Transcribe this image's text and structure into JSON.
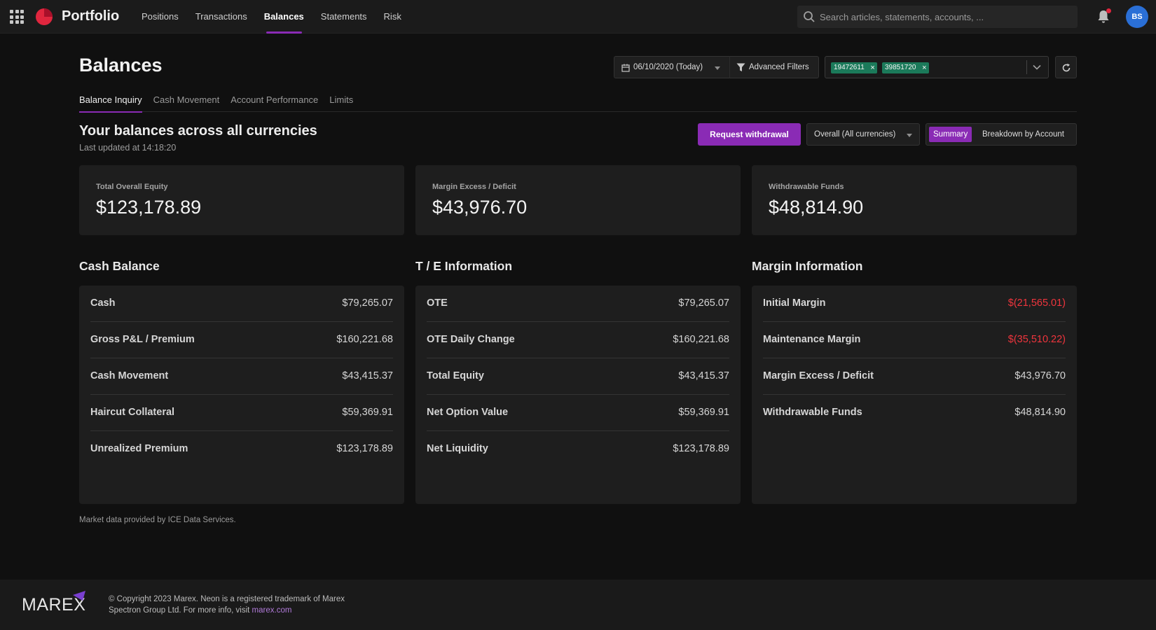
{
  "app": {
    "name": "Portfolio",
    "brand_color": "#8a2bb5",
    "logo_color": "#e0263e"
  },
  "nav": {
    "items": [
      {
        "label": "Positions"
      },
      {
        "label": "Transactions"
      },
      {
        "label": "Balances",
        "active": true
      },
      {
        "label": "Statements"
      },
      {
        "label": "Risk"
      }
    ]
  },
  "search": {
    "placeholder": "Search articles, statements, accounts, ..."
  },
  "user": {
    "initials": "BS"
  },
  "page": {
    "title": "Balances"
  },
  "filters": {
    "date": "06/10/2020 (Today)",
    "advanced_label": "Advanced Filters",
    "accounts": [
      "19472611",
      "39851720"
    ]
  },
  "tabs": [
    {
      "label": "Balance Inquiry",
      "active": true
    },
    {
      "label": "Cash Movement"
    },
    {
      "label": "Account Performance"
    },
    {
      "label": "Limits"
    }
  ],
  "section": {
    "title": "Your balances across all currencies",
    "updated": "Last updated at 14:18:20",
    "withdraw_label": "Request withdrawal",
    "currency": "Overall (All currencies)",
    "view_summary": "Summary",
    "view_breakdown": "Breakdown by Account"
  },
  "summary": [
    {
      "label": "Total Overall Equity",
      "value": "$123,178.89"
    },
    {
      "label": "Margin Excess / Deficit",
      "value": "$43,976.70"
    },
    {
      "label": "Withdrawable Funds",
      "value": "$48,814.90"
    }
  ],
  "panels": {
    "cash": {
      "title": "Cash Balance",
      "rows": [
        {
          "label": "Cash",
          "value": "$79,265.07"
        },
        {
          "label": "Gross P&L / Premium",
          "value": "$160,221.68"
        },
        {
          "label": "Cash Movement",
          "value": "$43,415.37"
        },
        {
          "label": "Haircut Collateral",
          "value": "$59,369.91"
        },
        {
          "label": "Unrealized Premium",
          "value": "$123,178.89"
        }
      ]
    },
    "te": {
      "title": "T / E Information",
      "rows": [
        {
          "label": "OTE",
          "value": "$79,265.07"
        },
        {
          "label": "OTE Daily Change",
          "value": "$160,221.68"
        },
        {
          "label": "Total Equity",
          "value": "$43,415.37"
        },
        {
          "label": "Net Option Value",
          "value": "$59,369.91"
        },
        {
          "label": "Net Liquidity",
          "value": "$123,178.89"
        }
      ]
    },
    "margin": {
      "title": "Margin Information",
      "rows": [
        {
          "label": "Initial Margin",
          "value": "$(21,565.01)",
          "negative": true
        },
        {
          "label": "Maintenance Margin",
          "value": "$(35,510.22)",
          "negative": true
        },
        {
          "label": "Margin Excess / Deficit",
          "value": "$43,976.70"
        },
        {
          "label": "Withdrawable Funds",
          "value": "$48,814.90"
        }
      ]
    }
  },
  "market_note": "Market data provided by ICE Data Services.",
  "footer": {
    "logo_text": "MAREX",
    "copyright": "© Copyright 2023 Marex. Neon is a registered trademark of Marex Spectron Group Ltd. For more info, visit",
    "link_text": "marex.com"
  }
}
